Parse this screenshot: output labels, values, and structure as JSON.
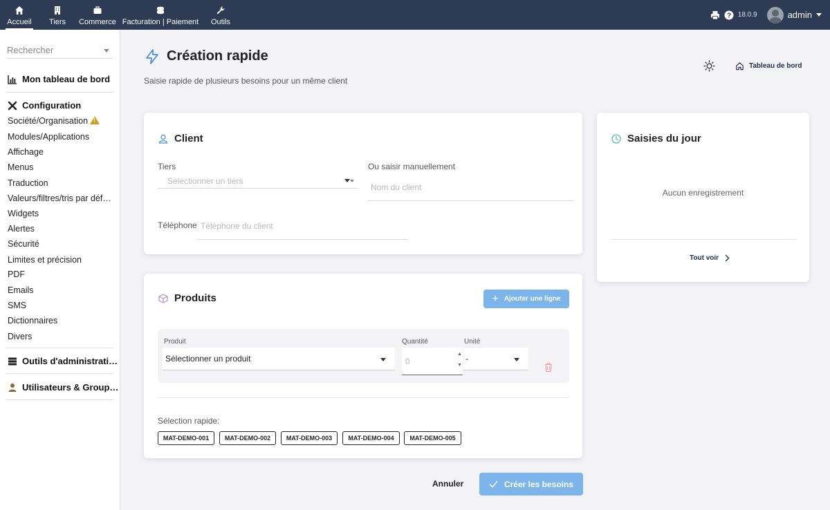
{
  "topbar": {
    "nav": [
      {
        "label": "Accueil",
        "icon": "home-icon"
      },
      {
        "label": "Tiers",
        "icon": "building-icon"
      },
      {
        "label": "Commerce",
        "icon": "briefcase-icon"
      },
      {
        "label": "Facturation | Paiement",
        "icon": "coins-icon"
      },
      {
        "label": "Outils",
        "icon": "wrench-icon"
      }
    ],
    "version": "18.0.9",
    "user": "admin"
  },
  "sidebar": {
    "search_placeholder": "Rechercher",
    "dashboard": "Mon tableau de bord",
    "config_title": "Configuration",
    "config_items": [
      "Société/Organisation",
      "Modules/Applications",
      "Affichage",
      "Menus",
      "Traduction",
      "Valeurs/filtres/tris par déf…",
      "Widgets",
      "Alertes",
      "Sécurité",
      "Limites et précision",
      "PDF",
      "Emails",
      "SMS",
      "Dictionnaires",
      "Divers"
    ],
    "admin_tools": "Outils d'administrati…",
    "users_groups": "Utilisateurs & Group…"
  },
  "page": {
    "title": "Création rapide",
    "subtitle": "Saisie rapide de plusieurs besoins pour un même client",
    "dashboard_link": "Tableau de bord"
  },
  "client": {
    "title": "Client",
    "tiers_label": "Tiers",
    "tiers_placeholder": "Sélectionner un tiers",
    "manual_label": "Ou saisir manuellement",
    "manual_placeholder": "Nom du client",
    "phone_label": "Téléphone",
    "phone_placeholder": "Téléphone du client"
  },
  "produits": {
    "title": "Produits",
    "add_line": "Ajouter une ligne",
    "col_produit": "Produit",
    "col_quantite": "Quantité",
    "col_unite": "Unité",
    "produit_value": "Sélectionner un produit",
    "quantite_placeholder": "0",
    "unite_value": "-",
    "quick_label": "Sélection rapide:",
    "quick_items": [
      "MAT-DEMO-001",
      "MAT-DEMO-002",
      "MAT-DEMO-003",
      "MAT-DEMO-004",
      "MAT-DEMO-005"
    ]
  },
  "actions": {
    "cancel": "Annuler",
    "create": "Créer les besoins"
  },
  "saisies": {
    "title": "Saisies du jour",
    "empty": "Aucun enregistrement",
    "see_all": "Tout voir"
  },
  "colors": {
    "topbar": "#2d3b55",
    "accent": "#7cb5ec",
    "warning": "#d29b1e"
  }
}
